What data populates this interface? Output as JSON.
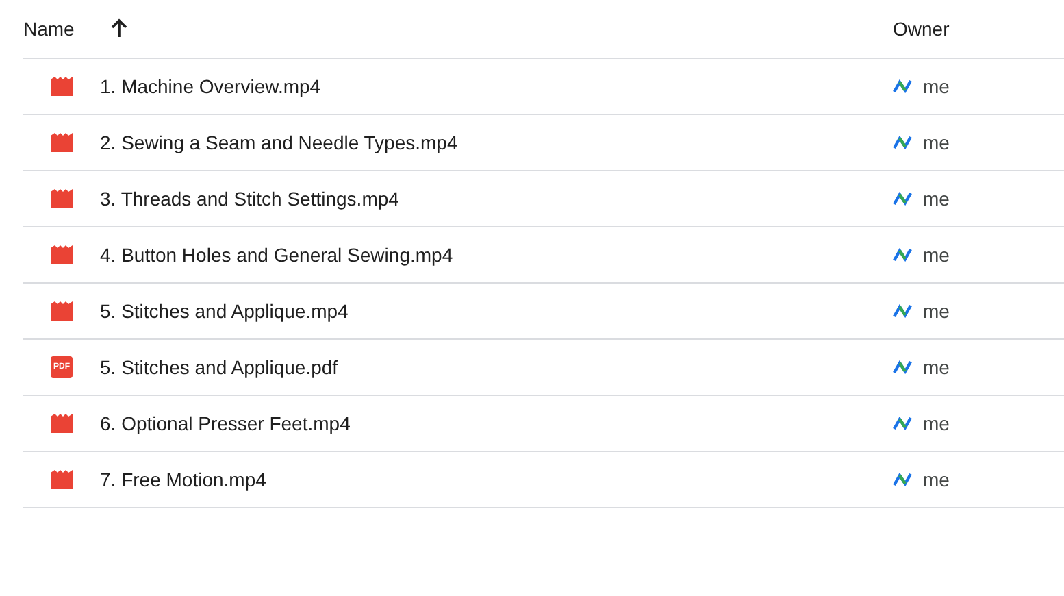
{
  "columns": {
    "name": "Name",
    "sort_ascending": true,
    "owner": "Owner"
  },
  "files": [
    {
      "kind": "video",
      "name": "1. Machine Overview.mp4",
      "owner": "me"
    },
    {
      "kind": "video",
      "name": "2. Sewing a Seam and Needle Types.mp4",
      "owner": "me"
    },
    {
      "kind": "video",
      "name": "3. Threads and Stitch Settings.mp4",
      "owner": "me"
    },
    {
      "kind": "video",
      "name": "4. Button Holes and General Sewing.mp4",
      "owner": "me"
    },
    {
      "kind": "video",
      "name": "5. Stitches and Applique.mp4",
      "owner": "me"
    },
    {
      "kind": "pdf",
      "icon_label": "PDF",
      "name": "5. Stitches and Applique.pdf",
      "owner": "me"
    },
    {
      "kind": "video",
      "name": "6. Optional Presser Feet.mp4",
      "owner": "me"
    },
    {
      "kind": "video",
      "name": "7. Free Motion.mp4",
      "owner": "me"
    }
  ]
}
